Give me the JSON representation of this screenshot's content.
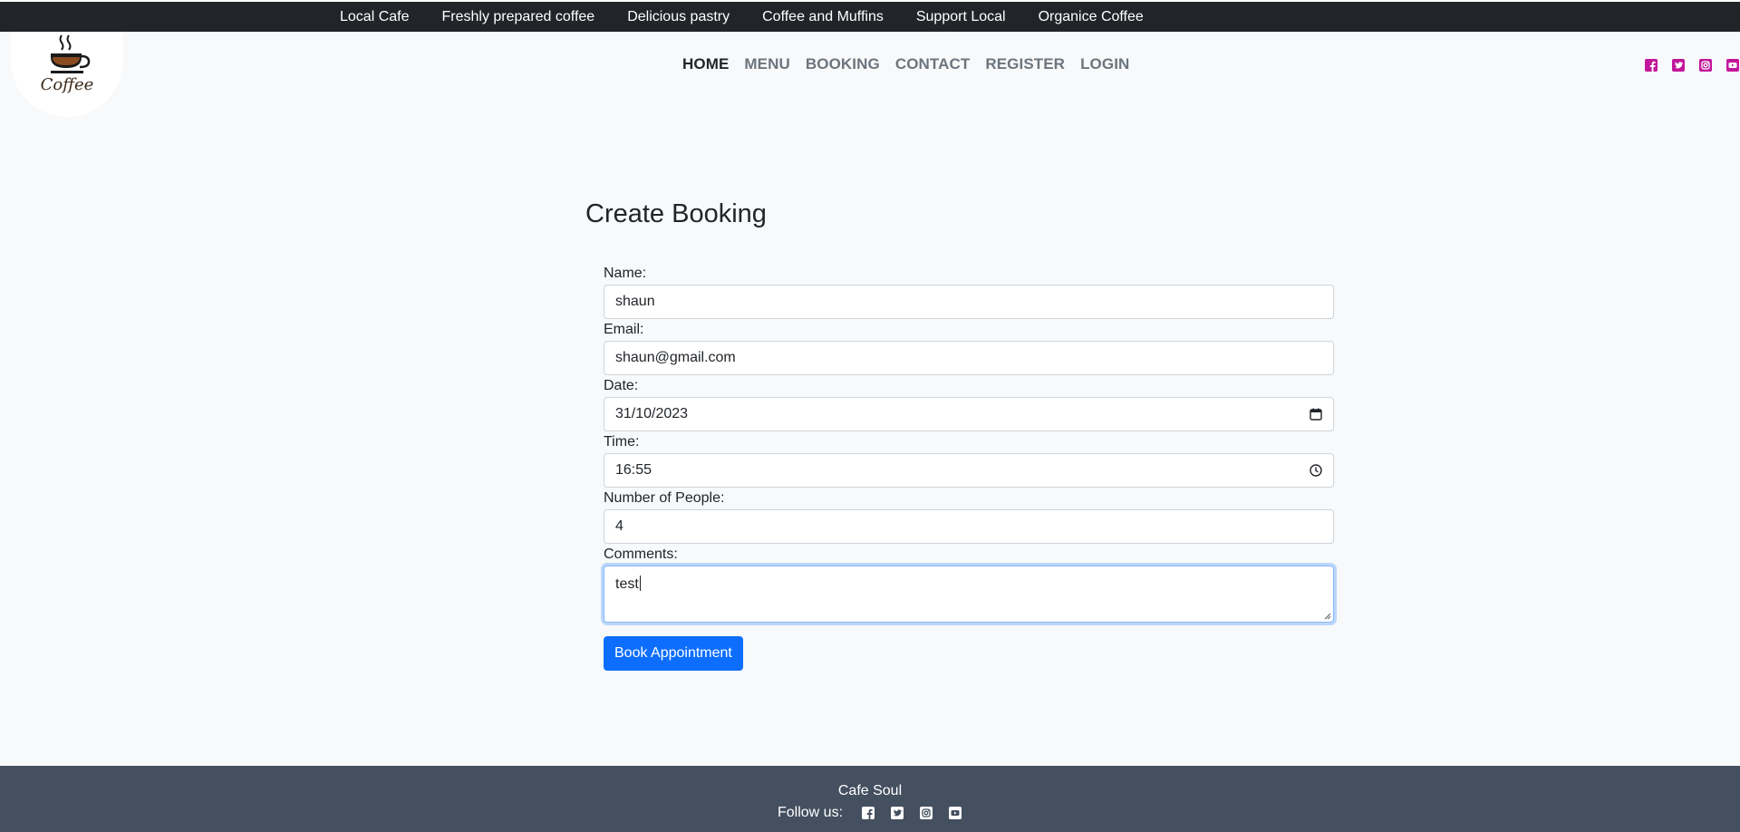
{
  "ticker": {
    "items": [
      "Local Cafe",
      "Freshly prepared coffee",
      "Delicious pastry",
      "Coffee and Muffins",
      "Support Local",
      "Organice Coffee"
    ]
  },
  "logo": {
    "text": "Coffee",
    "icon": "coffee-cup-icon"
  },
  "nav": {
    "items": [
      {
        "label": "HOME",
        "active": true
      },
      {
        "label": "MENU",
        "active": false
      },
      {
        "label": "BOOKING",
        "active": false
      },
      {
        "label": "CONTACT",
        "active": false
      },
      {
        "label": "REGISTER",
        "active": false
      },
      {
        "label": "LOGIN",
        "active": false
      }
    ]
  },
  "social": {
    "icons": [
      "facebook-icon",
      "twitter-icon",
      "instagram-icon",
      "youtube-icon"
    ],
    "top_color": "#c2179b",
    "footer_color": "#ffffff"
  },
  "page": {
    "title": "Create Booking"
  },
  "form": {
    "name_label": "Name:",
    "name_value": "shaun",
    "email_label": "Email:",
    "email_value": "shaun@gmail.com",
    "date_label": "Date:",
    "date_value": "31/10/2023",
    "time_label": "Time:",
    "time_value": "16:55",
    "people_label": "Number of People:",
    "people_value": "4",
    "comments_label": "Comments:",
    "comments_value": "test",
    "submit_label": "Book Appointment"
  },
  "footer": {
    "name": "Cafe Soul",
    "follow_label": "Follow us:"
  },
  "colors": {
    "ticker_bg": "#212529",
    "primary": "#0d6efd",
    "footer_bg": "#444f5f",
    "social_accent": "#c2179b"
  }
}
